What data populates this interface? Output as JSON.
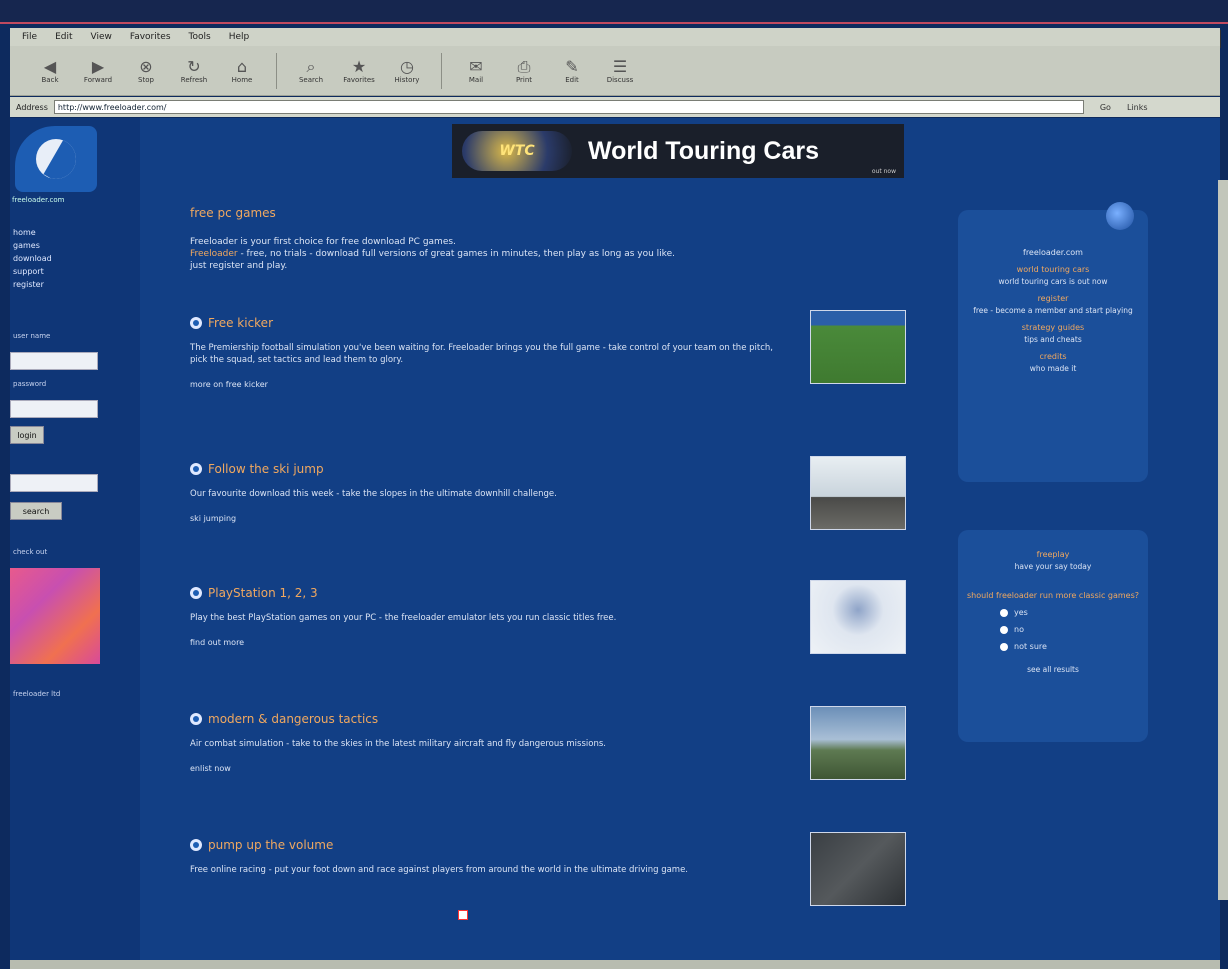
{
  "browser": {
    "menu": [
      "File",
      "Edit",
      "View",
      "Favorites",
      "Tools",
      "Help"
    ],
    "toolbar": [
      {
        "label": "Back",
        "icon": "back-icon"
      },
      {
        "label": "Forward",
        "icon": "forward-icon"
      },
      {
        "label": "Stop",
        "icon": "stop-icon"
      },
      {
        "label": "Refresh",
        "icon": "refresh-icon"
      },
      {
        "label": "Home",
        "icon": "home-icon"
      },
      {
        "label": "Search",
        "icon": "search-icon"
      },
      {
        "label": "Favorites",
        "icon": "favorites-icon"
      },
      {
        "label": "History",
        "icon": "history-icon"
      },
      {
        "label": "Mail",
        "icon": "mail-icon"
      },
      {
        "label": "Print",
        "icon": "print-icon"
      },
      {
        "label": "Edit",
        "icon": "edit-icon"
      },
      {
        "label": "Discuss",
        "icon": "discuss-icon"
      }
    ],
    "address_label": "Address",
    "address_value": "http://www.freeloader.com/",
    "go_label": "Go",
    "links_label": "Links"
  },
  "left_nav": {
    "logo_text": "freeloader.com",
    "links": [
      "home",
      "games",
      "download",
      "support",
      "register"
    ],
    "user_label": "user name",
    "pass_label": "password",
    "login_button": "login",
    "search_button": "search",
    "promo_label": "check out",
    "footer_text": "freeloader ltd"
  },
  "banner": {
    "logo_text": "WTC",
    "title": "World Touring Cars",
    "tag": "out now"
  },
  "content": {
    "section_title": "free pc games",
    "intro_line1": "Freeloader is your first choice for free download PC games.",
    "intro_highlight": "Freeloader",
    "intro_line2": " - free, no trials - download full versions of great games in minutes, then play as long as you like.",
    "intro_line3": "just register and play.",
    "articles": [
      {
        "title": "Free kicker",
        "text": "The Premiership football simulation you've been waiting for. Freeloader brings you the full game - take control of your team on the pitch, pick the squad, set tactics and lead them to glory.",
        "more": "more on free kicker"
      },
      {
        "title": "Follow the ski jump",
        "text": "Our favourite download this week - take the slopes in the ultimate downhill challenge.",
        "more": "ski jumping"
      },
      {
        "title": "PlayStation 1, 2, 3",
        "text": "Play the best PlayStation games on your PC - the freeloader emulator lets you run classic titles free.",
        "more": "find out more"
      },
      {
        "title": "modern & dangerous tactics",
        "text": "Air combat simulation - take to the skies in the latest military aircraft and fly dangerous missions.",
        "more": "enlist now"
      },
      {
        "title": "pump up the volume",
        "text": "Free online racing - put your foot down and race against players from around the world in the ultimate driving game.",
        "more": ""
      }
    ]
  },
  "right_col": {
    "site_name": "freeloader.com",
    "items": [
      {
        "title": "world touring cars",
        "text": "world touring cars is out now"
      },
      {
        "title": "register",
        "text": "free - become a member and start playing"
      },
      {
        "title": "strategy guides",
        "text": "tips and cheats"
      },
      {
        "title": "credits",
        "text": "who made it"
      }
    ],
    "poll_title": "freeplay",
    "poll_text": "have your say today",
    "poll_question": "should freeloader run more classic games?",
    "poll_options": [
      "yes",
      "no",
      "not sure"
    ],
    "poll_footer": "see all results"
  }
}
